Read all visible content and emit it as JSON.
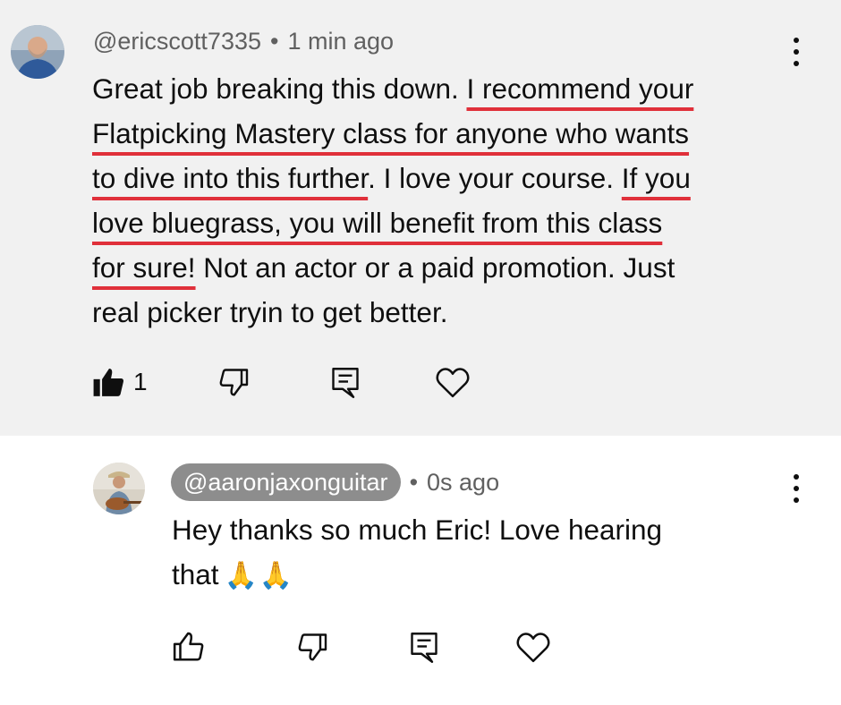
{
  "comment": {
    "handle": "@ericscott7335",
    "time": "1 min ago",
    "lines": [
      {
        "pre": "Great job breaking this down. ",
        "ul": "I recommend your",
        "post": ""
      },
      {
        "pre": "",
        "ul": "Flatpicking Mastery class for anyone who wants",
        "post": ""
      },
      {
        "pre": "",
        "ul": "to dive into this further",
        "post": ". I love your course. ",
        "ul2": "If you"
      },
      {
        "pre": "",
        "ul": "love bluegrass, you will benefit from this class",
        "post": ""
      },
      {
        "pre": "",
        "ul": "for sure!",
        "post": " Not an actor or a paid promotion. Just"
      },
      {
        "pre": "real picker tryin to get better.",
        "ul": "",
        "post": ""
      }
    ],
    "like_count": "1",
    "icons": {
      "like": "thumbs-up-filled-icon",
      "dislike": "thumbs-down-icon",
      "reply": "comment-icon",
      "heart": "heart-icon",
      "menu": "more-vertical-icon"
    }
  },
  "reply": {
    "handle": "@aaronjaxonguitar",
    "time": "0s ago",
    "text_line1": "Hey thanks so much Eric! Love hearing",
    "text_line2": "that",
    "emoji": "🙏🙏",
    "icons": {
      "like": "thumbs-up-icon",
      "dislike": "thumbs-down-icon",
      "reply": "comment-icon",
      "heart": "heart-icon",
      "menu": "more-vertical-icon"
    }
  },
  "colors": {
    "comment_bg": "#f1f1f1",
    "underline": "#e0303a",
    "meta_text": "#606060",
    "handle_pill": "#8d8d8d"
  }
}
